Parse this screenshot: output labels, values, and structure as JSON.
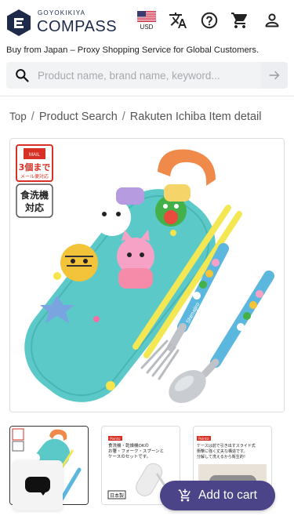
{
  "header": {
    "brand_top": "GOYOKIKIYA",
    "brand_main": "COMPASS",
    "currency": "USD"
  },
  "tagline": "Buy from Japan – Proxy Shopping Service for Global Customers.",
  "search": {
    "placeholder": "Product name, brand name, keyword..."
  },
  "breadcrumb": {
    "items": [
      "Top",
      "Product Search",
      "Rakuten Ichiba Item detail"
    ]
  },
  "product_image": {
    "badge_top": "MAIL",
    "badge_middle": "3個まで",
    "badge_bottom": "メール便対応",
    "badge2_line1": "食洗機",
    "badge2_line2": "対応",
    "brand_on_utensils": "Shimajiro"
  },
  "thumbnails": {
    "t2_label": "Point①",
    "t2_line1": "食洗機・乾燥機OKの",
    "t2_line2": "お箸・フォーク・スプーンと",
    "t2_line3": "ケースのセットです。",
    "t2_footer": "日本製",
    "t3_label": "Point②",
    "t3_line1": "ケースは前で引き出すスライド式",
    "t3_line2": "衝撃に強く丈夫な構造です。",
    "t3_line3": "分解して洗えるから衛生的！"
  },
  "cart": {
    "label": "Add to cart"
  },
  "colors": {
    "brand": "#1e2a4a",
    "button": "#4b4488",
    "case": "#5cc9c9"
  }
}
